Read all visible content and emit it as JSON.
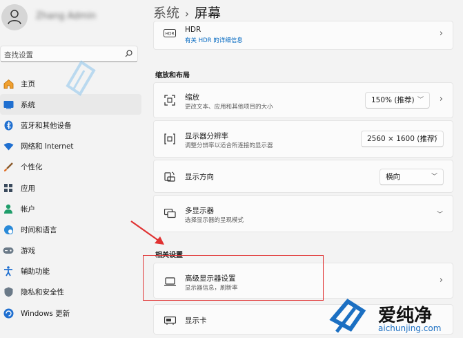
{
  "sidebar": {
    "user_name": "Zhang Admin",
    "search": {
      "placeholder": "查找设置"
    },
    "items": [
      {
        "label": "主页",
        "icon": "home-icon"
      },
      {
        "label": "系统",
        "icon": "system-icon",
        "selected": true
      },
      {
        "label": "蓝牙和其他设备",
        "icon": "bluetooth-icon"
      },
      {
        "label": "网络和 Internet",
        "icon": "wifi-icon"
      },
      {
        "label": "个性化",
        "icon": "brush-icon"
      },
      {
        "label": "应用",
        "icon": "apps-icon"
      },
      {
        "label": "帐户",
        "icon": "account-icon"
      },
      {
        "label": "时间和语言",
        "icon": "globe-clock-icon"
      },
      {
        "label": "游戏",
        "icon": "gamepad-icon"
      },
      {
        "label": "辅助功能",
        "icon": "accessibility-icon"
      },
      {
        "label": "隐私和安全性",
        "icon": "shield-icon"
      },
      {
        "label": "Windows 更新",
        "icon": "update-icon"
      }
    ]
  },
  "breadcrumb": {
    "root": "系统",
    "current": "屏幕"
  },
  "hdr": {
    "title": "HDR",
    "link": "有关 HDR 的详细信息",
    "icon": "hdr-icon"
  },
  "scale_layout": {
    "heading": "缩放和布局",
    "scale": {
      "title": "缩放",
      "subtitle": "更改文本、应用和其他项目的大小",
      "value": "150% (推荐)",
      "icon": "scale-icon"
    },
    "resolution": {
      "title": "显示器分辨率",
      "subtitle": "调整分辨率以适合所连接的显示器",
      "value": "2560 × 1600 (推荐)",
      "icon": "resolution-icon"
    },
    "orientation": {
      "title": "显示方向",
      "value": "横向",
      "icon": "rotate-icon"
    },
    "multi": {
      "title": "多显示器",
      "subtitle": "选择显示器的呈现模式",
      "icon": "multi-display-icon"
    }
  },
  "related": {
    "heading": "相关设置",
    "advanced": {
      "title": "高级显示器设置",
      "subtitle": "显示器信息，刷新率",
      "icon": "monitor-icon"
    },
    "gpu": {
      "title": "显示卡",
      "icon": "gpu-icon"
    }
  },
  "watermark": {
    "site_cn": "爱纯净",
    "site_url": "aichunjing.com",
    "brand_color": "#1b6fc2"
  },
  "colors": {
    "accent": "#0067c0",
    "highlight": "#e03131"
  }
}
